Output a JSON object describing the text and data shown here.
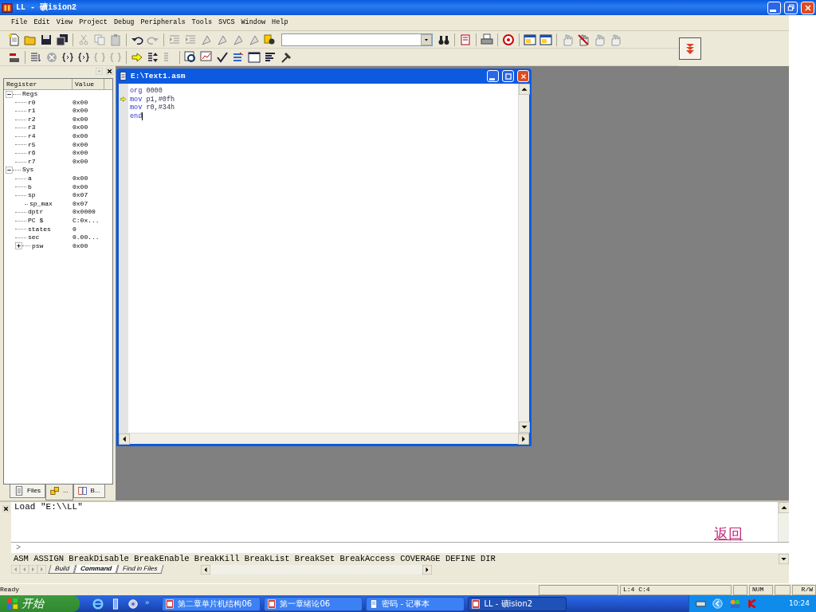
{
  "window": {
    "title": "LL  - 礦ision2"
  },
  "menu": [
    "File",
    "Edit",
    "View",
    "Project",
    "Debug",
    "Peripherals",
    "Tools",
    "SVCS",
    "Window",
    "Help"
  ],
  "register_panel": {
    "columns": [
      "Register",
      "Value"
    ],
    "tree": [
      {
        "label": "Regs",
        "expanded": true,
        "children": [
          {
            "label": "r0",
            "value": "0x00"
          },
          {
            "label": "r1",
            "value": "0x00"
          },
          {
            "label": "r2",
            "value": "0x00"
          },
          {
            "label": "r3",
            "value": "0x00"
          },
          {
            "label": "r4",
            "value": "0x00"
          },
          {
            "label": "r5",
            "value": "0x00"
          },
          {
            "label": "r6",
            "value": "0x00"
          },
          {
            "label": "r7",
            "value": "0x00"
          }
        ]
      },
      {
        "label": "Sys",
        "expanded": true,
        "children": [
          {
            "label": "a",
            "value": "0x00"
          },
          {
            "label": "b",
            "value": "0x00"
          },
          {
            "label": "sp",
            "value": "0x07",
            "children": [
              {
                "label": "sp_max",
                "value": "0x07"
              }
            ]
          },
          {
            "label": "dptr",
            "value": "0x0000"
          },
          {
            "label": "PC  $",
            "value": "C:0x..."
          },
          {
            "label": "states",
            "value": "0"
          },
          {
            "label": "sec",
            "value": "0.00..."
          },
          {
            "label": "psw",
            "value": "0x00",
            "expanded": false
          }
        ]
      }
    ],
    "tabs": [
      {
        "label": "Files",
        "selected": false
      },
      {
        "label": "...",
        "selected": true
      },
      {
        "label": "B...",
        "selected": false
      }
    ]
  },
  "editor": {
    "title": "E:\\Text1.asm",
    "lines": [
      {
        "keyword": "org",
        "operand": "0000",
        "current": false,
        "cursor": false
      },
      {
        "keyword": "mov",
        "operand": "p1,#0fh",
        "current": true,
        "cursor": false
      },
      {
        "keyword": "mov",
        "operand": "r0,#34h",
        "current": false,
        "cursor": false
      },
      {
        "keyword": "end",
        "current": false,
        "cursor": true
      }
    ]
  },
  "output": {
    "lines": [
      "Load \"E:\\\\LL\""
    ],
    "link": "返回",
    "prompt": ">",
    "command_hint": "ASM ASSIGN BreakDisable BreakEnable BreakKill BreakList BreakSet BreakAccess COVERAGE DEFINE DIR",
    "tabs": [
      {
        "label": "Build",
        "selected": false
      },
      {
        "label": "Command",
        "selected": true
      },
      {
        "label": "Find in Files",
        "selected": false
      }
    ]
  },
  "status_bar": {
    "message": "Ready",
    "position": "L:4 C:4",
    "num_lock": "NUM",
    "access": "R/W"
  },
  "taskbar": {
    "start": "开始",
    "more": "»",
    "tasks": [
      {
        "label": "第二章单片机结构06",
        "selected": false
      },
      {
        "label": "第一章绪论06",
        "selected": false
      },
      {
        "label": "密码 - 记事本",
        "selected": false
      },
      {
        "label": "LL  - 礦ision2",
        "selected": true
      }
    ],
    "clock": "10:24"
  }
}
